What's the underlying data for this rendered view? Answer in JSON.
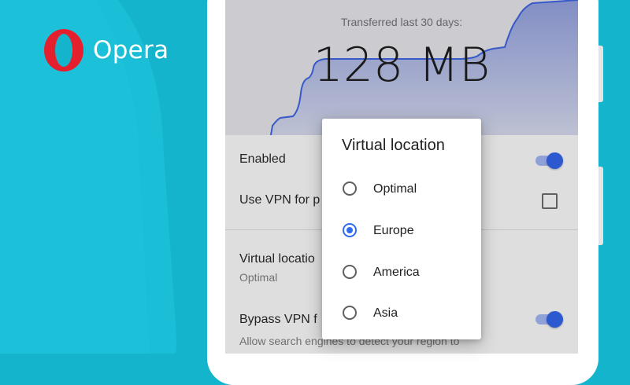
{
  "brand": {
    "name": "Opera",
    "logo_icon": "opera-o-logo",
    "logo_color": "#e5202e"
  },
  "colors": {
    "background": "#14b4cc",
    "accent": "#2d6cf0"
  },
  "stats": {
    "label": "Transferred last 30 days:",
    "value": "128 MB"
  },
  "settings": {
    "enabled_label": "Enabled",
    "enabled_state": true,
    "use_vpn_label": "Use VPN for p",
    "use_vpn_checked": false,
    "virtual_location_label": "Virtual locatio",
    "virtual_location_value": "Optimal",
    "bypass_label": "Bypass VPN f",
    "bypass_state": true,
    "bypass_sub": "Allow search engines to detect your region to"
  },
  "dialog": {
    "title": "Virtual location",
    "options": [
      {
        "label": "Optimal",
        "selected": false
      },
      {
        "label": "Europe",
        "selected": true
      },
      {
        "label": "America",
        "selected": false
      },
      {
        "label": "Asia",
        "selected": false
      }
    ]
  }
}
